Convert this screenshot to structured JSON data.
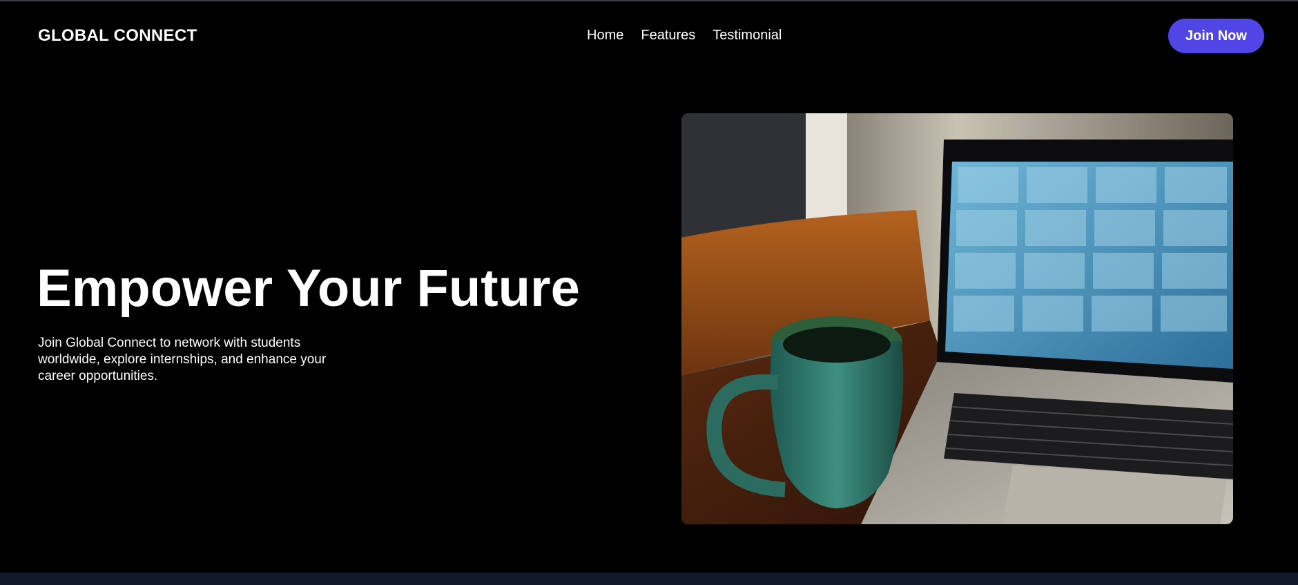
{
  "brand": {
    "name": "GLOBAL CONNECT"
  },
  "nav": {
    "links": [
      {
        "label": "Home"
      },
      {
        "label": "Features"
      },
      {
        "label": "Testimonial"
      }
    ],
    "cta_label": "Join Now"
  },
  "hero": {
    "title": "Empower Your Future",
    "description": "Join Global Connect to network with students worldwide, explore internships, and enhance your career opportunities.",
    "image_icon": "laptop-video-call-with-mug-photo"
  },
  "colors": {
    "background": "#000000",
    "accent": "#4f46e5",
    "footer": "#111827",
    "text": "#ffffff"
  }
}
